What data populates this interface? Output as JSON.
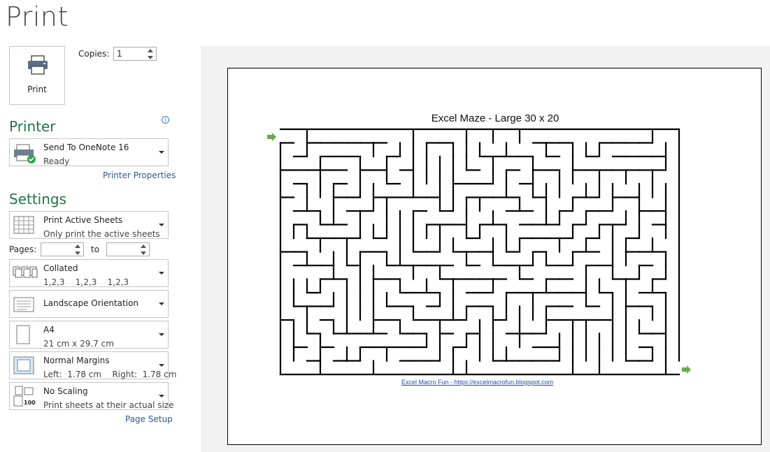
{
  "backstage": {
    "title": "Print"
  },
  "print_button": {
    "label": "Print"
  },
  "copies": {
    "label": "Copies:",
    "value": "1"
  },
  "printer": {
    "heading": "Printer",
    "name": "Send To OneNote 16",
    "status": "Ready",
    "properties_link": "Printer Properties"
  },
  "settings": {
    "heading": "Settings",
    "what": {
      "title": "Print Active Sheets",
      "sub": "Only print the active sheets"
    },
    "pages": {
      "label": "Pages:",
      "to_label": "to",
      "from": "",
      "to": ""
    },
    "collation": {
      "title": "Collated",
      "sub": "1,2,3    1,2,3    1,2,3"
    },
    "orientation": {
      "title": "Landscape Orientation"
    },
    "paper": {
      "title": "A4",
      "sub": "21 cm x 29.7 cm"
    },
    "margins": {
      "title": "Normal Margins",
      "sub": "Left:  1.78 cm    Right:  1.78 cm"
    },
    "scaling": {
      "title": "No Scaling",
      "sub": "Print sheets at their actual size",
      "icon_text": "100"
    },
    "page_setup_link": "Page Setup"
  },
  "preview": {
    "maze_title": "Excel Maze - Large 30 x 20",
    "footer": "Excel Macro Fun - https://excelmacrofun.blogspot.com",
    "maze_cols": 30,
    "maze_rows": 18,
    "arrow_color": "#6aa84f"
  },
  "colors": {
    "accent": "#217346",
    "link": "#2b579a"
  }
}
